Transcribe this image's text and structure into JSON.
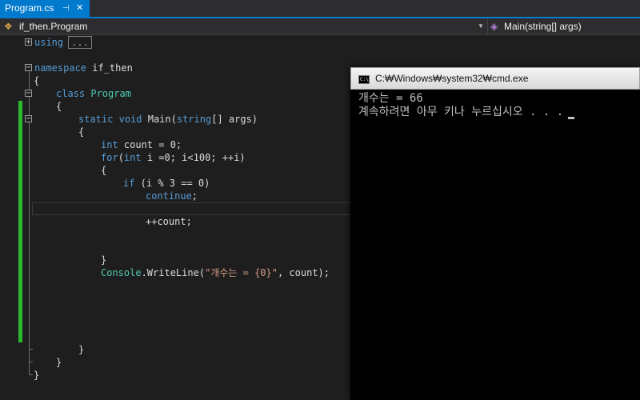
{
  "tab": {
    "label": "Program.cs",
    "pin_icon": "pin-icon",
    "close_icon": "close-icon"
  },
  "nav": {
    "class_path": "if_then.Program",
    "method": "Main(string[] args)"
  },
  "code": {
    "using_kw": "using",
    "collapsed": "...",
    "namespace_kw": "namespace",
    "namespace_name": " if_then",
    "open_brace": "{",
    "close_brace": "}",
    "class_kw": "class",
    "class_name": "Program",
    "static_kw": "static",
    "void_kw": "void",
    "main_sig_a": " Main(",
    "string_kw": "string",
    "main_sig_b": "[] args)",
    "int_kw": "int",
    "count_decl": " count = 0;",
    "for_kw": "for",
    "for_a": "(",
    "for_b": " i =0; i<100; ++i)",
    "if_kw": "if",
    "if_cond": " (i % 3 == 0)",
    "continue_kw": "continue",
    "semicolon": ";",
    "increment": "++count;",
    "console_cls": "Console",
    "writeline": ".WriteLine(",
    "format_str": "\"개수는 = {0}\"",
    "writeline_end": ", count);"
  },
  "console": {
    "title": "C:₩Windows₩system32₩cmd.exe",
    "output_line1": "개수는 = 66",
    "output_line2": "계속하려면 아무 키나 누르십시오 . . ."
  },
  "colors": {
    "keyword": "#569cd6",
    "type": "#4ec9b0",
    "string": "#d69d85",
    "accent": "#007acc",
    "change_bar": "#2eb82e"
  }
}
